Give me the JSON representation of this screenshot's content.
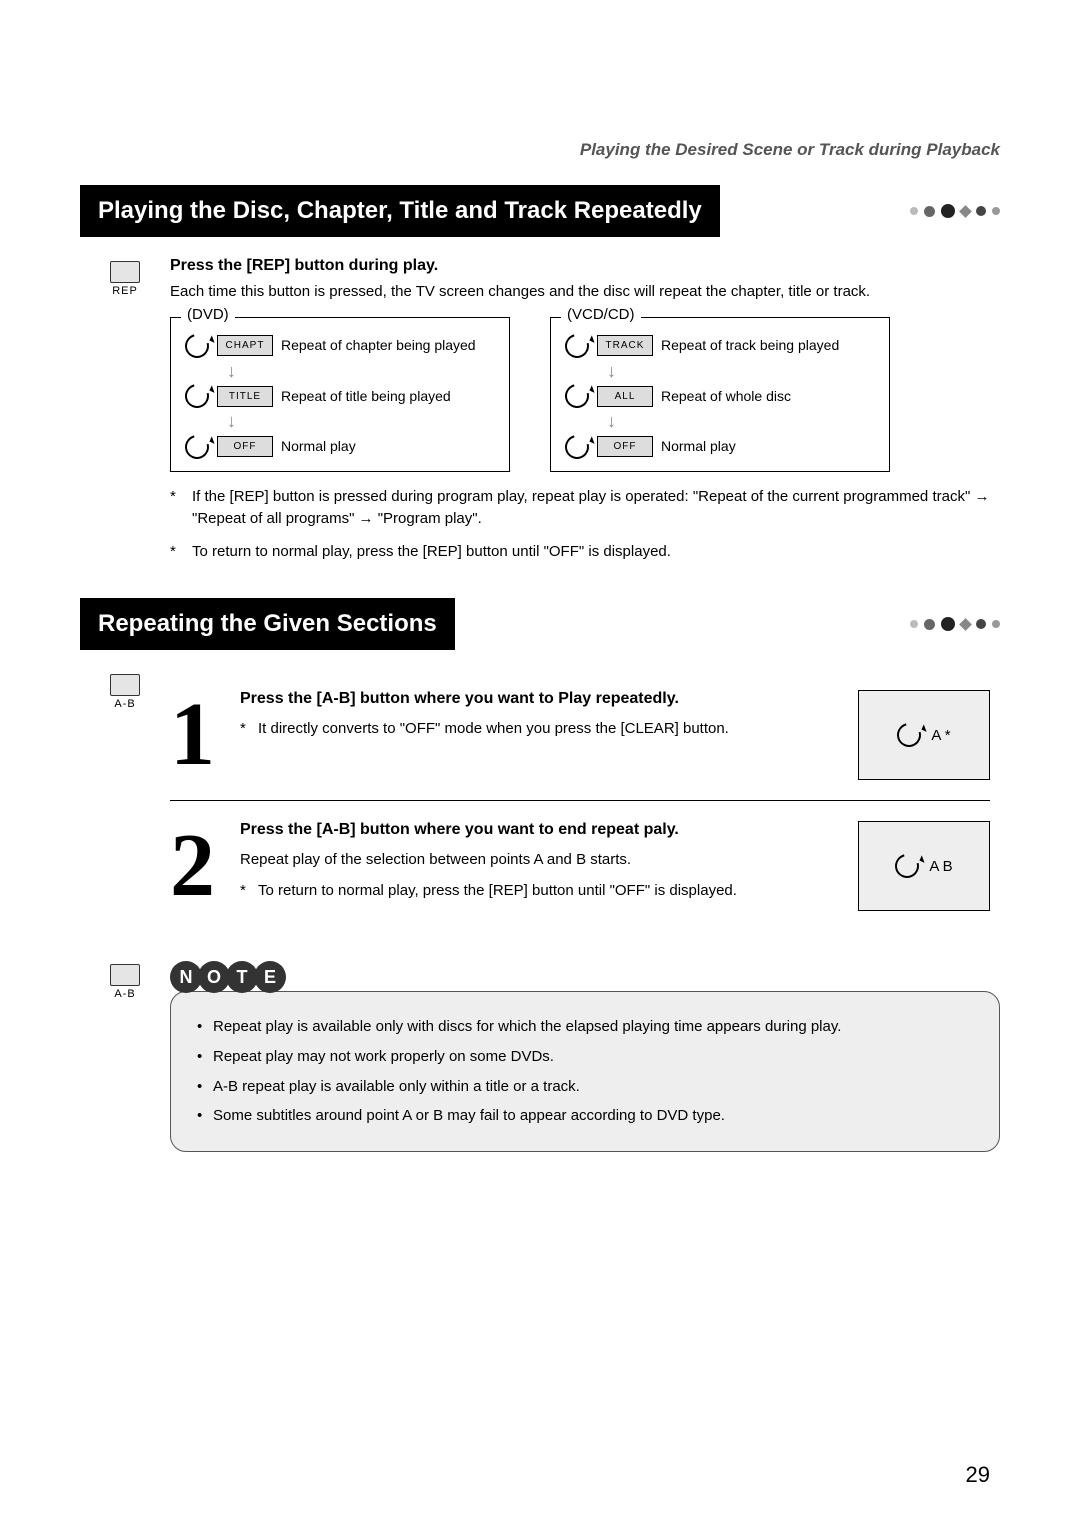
{
  "breadcrumb": "Playing the Desired Scene or Track during Playback",
  "section1": {
    "title": "Playing the Disc, Chapter, Title and Track Repeatedly",
    "button_label": "REP",
    "heading": "Press the [REP] button during play.",
    "explain": "Each time this button is pressed, the TV screen changes and the disc will repeat the chapter, title or track.",
    "dvd": {
      "title": "(DVD)",
      "rows": [
        {
          "chip": "CHAPT",
          "desc": "Repeat of chapter being played"
        },
        {
          "chip": "TITLE",
          "desc": "Repeat of title being played"
        },
        {
          "chip": "OFF",
          "desc": "Normal play"
        }
      ]
    },
    "vcd": {
      "title": "(VCD/CD)",
      "rows": [
        {
          "chip": "TRACK",
          "desc": "Repeat of track being played"
        },
        {
          "chip": "ALL",
          "desc": "Repeat of whole disc"
        },
        {
          "chip": "OFF",
          "desc": "Normal play"
        }
      ]
    },
    "notes": [
      "If the [REP] button is pressed during program play, repeat play is operated: \"Repeat of the current programmed track\" → \"Repeat of all programs\" → \"Program play\".",
      "To return to normal play, press the [REP] button until \"OFF\" is displayed."
    ]
  },
  "section2": {
    "title": "Repeating the Given Sections",
    "button_label": "A-B",
    "step1": {
      "num": "1",
      "heading": "Press the [A-B] button where you want to Play repeatedly.",
      "sub": "It directly converts to \"OFF\" mode when you press the [CLEAR] button.",
      "indicator": "A   *"
    },
    "step2": {
      "num": "2",
      "heading": "Press the [A-B] button where you want to end repeat paly.",
      "body": "Repeat play of the selection between points A and B starts.",
      "sub": "To return to normal play, press the [REP] button until \"OFF\" is displayed.",
      "indicator": "A   B"
    }
  },
  "note_letters": [
    "N",
    "O",
    "T",
    "E"
  ],
  "note_list": [
    "Repeat play is available only with discs for which the elapsed playing time appears during play.",
    "Repeat play may not work properly on some DVDs.",
    "A-B repeat play is available only within a title or a track.",
    "Some subtitles around point A or B may fail to appear according to DVD type."
  ],
  "page_number": "29"
}
